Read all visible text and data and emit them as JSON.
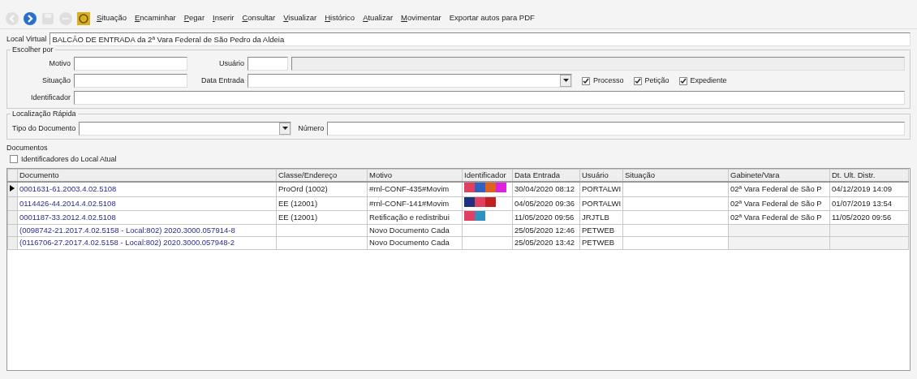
{
  "toolbar": {
    "icons": [
      {
        "kind": "back",
        "disabled": true
      },
      {
        "kind": "forward",
        "disabled": false
      },
      {
        "kind": "save",
        "disabled": true
      },
      {
        "kind": "circle",
        "disabled": true
      },
      {
        "kind": "yellow",
        "disabled": false
      }
    ],
    "menu": [
      {
        "label": "Situação",
        "mnemonic": true
      },
      {
        "label": "Encaminhar",
        "mnemonic": true
      },
      {
        "label": "Pegar",
        "mnemonic": true
      },
      {
        "label": "Inserir",
        "mnemonic": true
      },
      {
        "label": "Consultar",
        "mnemonic": true
      },
      {
        "label": "Visualizar",
        "mnemonic": true
      },
      {
        "label": "Histórico",
        "mnemonic": true
      },
      {
        "label": "Atualizar",
        "mnemonic": true
      },
      {
        "label": "Movimentar",
        "mnemonic": true
      },
      {
        "label": "Exportar autos para PDF",
        "mnemonic": false
      }
    ]
  },
  "local_virtual": {
    "label": "Local Virtual",
    "value": "BALCÃO DE ENTRADA da 2ª Vara Federal de São Pedro da Aldeia"
  },
  "escolher_por": {
    "title": "Escolher por",
    "motivo": "Motivo",
    "usuario": "Usuário",
    "situacao": "Situação",
    "data_entrada": "Data Entrada",
    "identificador": "Identificador",
    "checks": [
      {
        "label": "Processo",
        "checked": true
      },
      {
        "label": "Petição",
        "checked": true
      },
      {
        "label": "Expediente",
        "checked": true
      }
    ]
  },
  "localizacao": {
    "title": "Localização Rápida",
    "tipo": "Tipo do Documento",
    "numero": "Número"
  },
  "documentos": {
    "title": "Documentos",
    "check": {
      "label": "Identificadores do Local Atual",
      "checked": false
    },
    "columns": [
      "Documento",
      "Classe/Endereço",
      "Motivo",
      "Identificador",
      "Data Entrada",
      "Usuário",
      "Situação",
      "Gabinete/Vara",
      "Dt. Ult. Distr."
    ],
    "rows": [
      {
        "selected": true,
        "cells": [
          "0001631-61.2003.4.02.5108",
          "ProOrd (1002)",
          "#rnl-CONF-435#Movim",
          "",
          "30/04/2020 08:12",
          "PORTALWI",
          "",
          "02ª Vara Federal de São P",
          "04/12/2019 14:09"
        ],
        "tags": [
          {
            "color": "#e04060"
          },
          {
            "color": "#3060c0"
          },
          {
            "color": "#e06020"
          },
          {
            "color": "#e020e0"
          }
        ]
      },
      {
        "selected": false,
        "cells": [
          "0114426-44.2014.4.02.5108",
          "EE (12001)",
          "#rnl-CONF-141#Movim",
          "",
          "04/05/2020 09:36",
          "PORTALWI",
          "",
          "02ª Vara Federal de São P",
          "01/07/2019 13:54"
        ],
        "tags": [
          {
            "color": "#203080"
          },
          {
            "color": "#e04060"
          },
          {
            "color": "#c02020"
          }
        ]
      },
      {
        "selected": false,
        "cells": [
          "0001187-33.2012.4.02.5108",
          "EE (12001)",
          "Retificação e redistribui",
          "",
          "11/05/2020 09:56",
          "JRJTLB",
          "",
          "02ª Vara Federal de São P",
          "11/05/2020 09:56"
        ],
        "tags": [
          {
            "color": "#e04060"
          },
          {
            "color": "#3090c0"
          }
        ]
      },
      {
        "selected": false,
        "cells": [
          "(0098742-21.2017.4.02.5158 - Local:802) 2020.3000.057914-8",
          "",
          "Novo Documento Cada",
          "",
          "25/05/2020 12:46",
          "PETWEB",
          "",
          "",
          ""
        ],
        "tags": []
      },
      {
        "selected": false,
        "cells": [
          "(0116706-27.2017.4.02.5158 - Local:802) 2020.3000.057948-2",
          "",
          "Novo Documento Cada",
          "",
          "25/05/2020 13:42",
          "PETWEB",
          "",
          "",
          ""
        ],
        "tags": []
      }
    ]
  }
}
